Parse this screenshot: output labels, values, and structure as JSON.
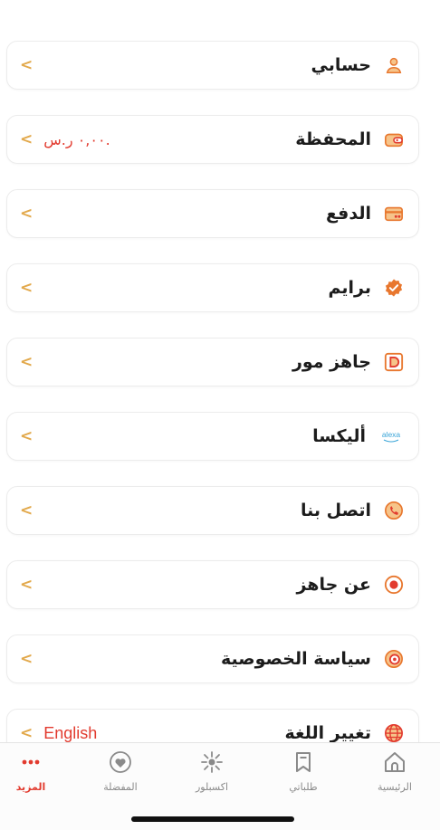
{
  "menu": {
    "items": [
      {
        "label": "حسابي",
        "icon": "person-icon"
      },
      {
        "label": "المحفظة",
        "icon": "wallet-icon",
        "value": "٠,٠٠ ر.س."
      },
      {
        "label": "الدفع",
        "icon": "card-icon"
      },
      {
        "label": "برايم",
        "icon": "prime-badge-icon"
      },
      {
        "label": "جاهز مور",
        "icon": "d-logo-icon"
      },
      {
        "label": "أليكسا",
        "icon": "alexa-logo-icon",
        "logo_text": "alexa"
      },
      {
        "label": "اتصل بنا",
        "icon": "phone-icon"
      },
      {
        "label": "عن جاهز",
        "icon": "target-icon"
      },
      {
        "label": "سياسة الخصوصية",
        "icon": "shield-icon"
      },
      {
        "label": "تغيير اللغة",
        "icon": "globe-icon",
        "value": "English"
      }
    ],
    "chevron": "<"
  },
  "tabbar": {
    "tabs": [
      {
        "label": "الرئيسية",
        "icon": "home-icon",
        "active": false
      },
      {
        "label": "طلباتي",
        "icon": "bookmark-icon",
        "active": false
      },
      {
        "label": "اكسبلور",
        "icon": "sparkle-icon",
        "active": false
      },
      {
        "label": "المفضلة",
        "icon": "heart-icon",
        "active": false
      },
      {
        "label": "المزيد",
        "icon": "more-dots-icon",
        "active": true
      }
    ]
  },
  "colors": {
    "accent": "#e23b2f",
    "chevron": "#e2a84a",
    "icon_orange": "#e8772e"
  }
}
